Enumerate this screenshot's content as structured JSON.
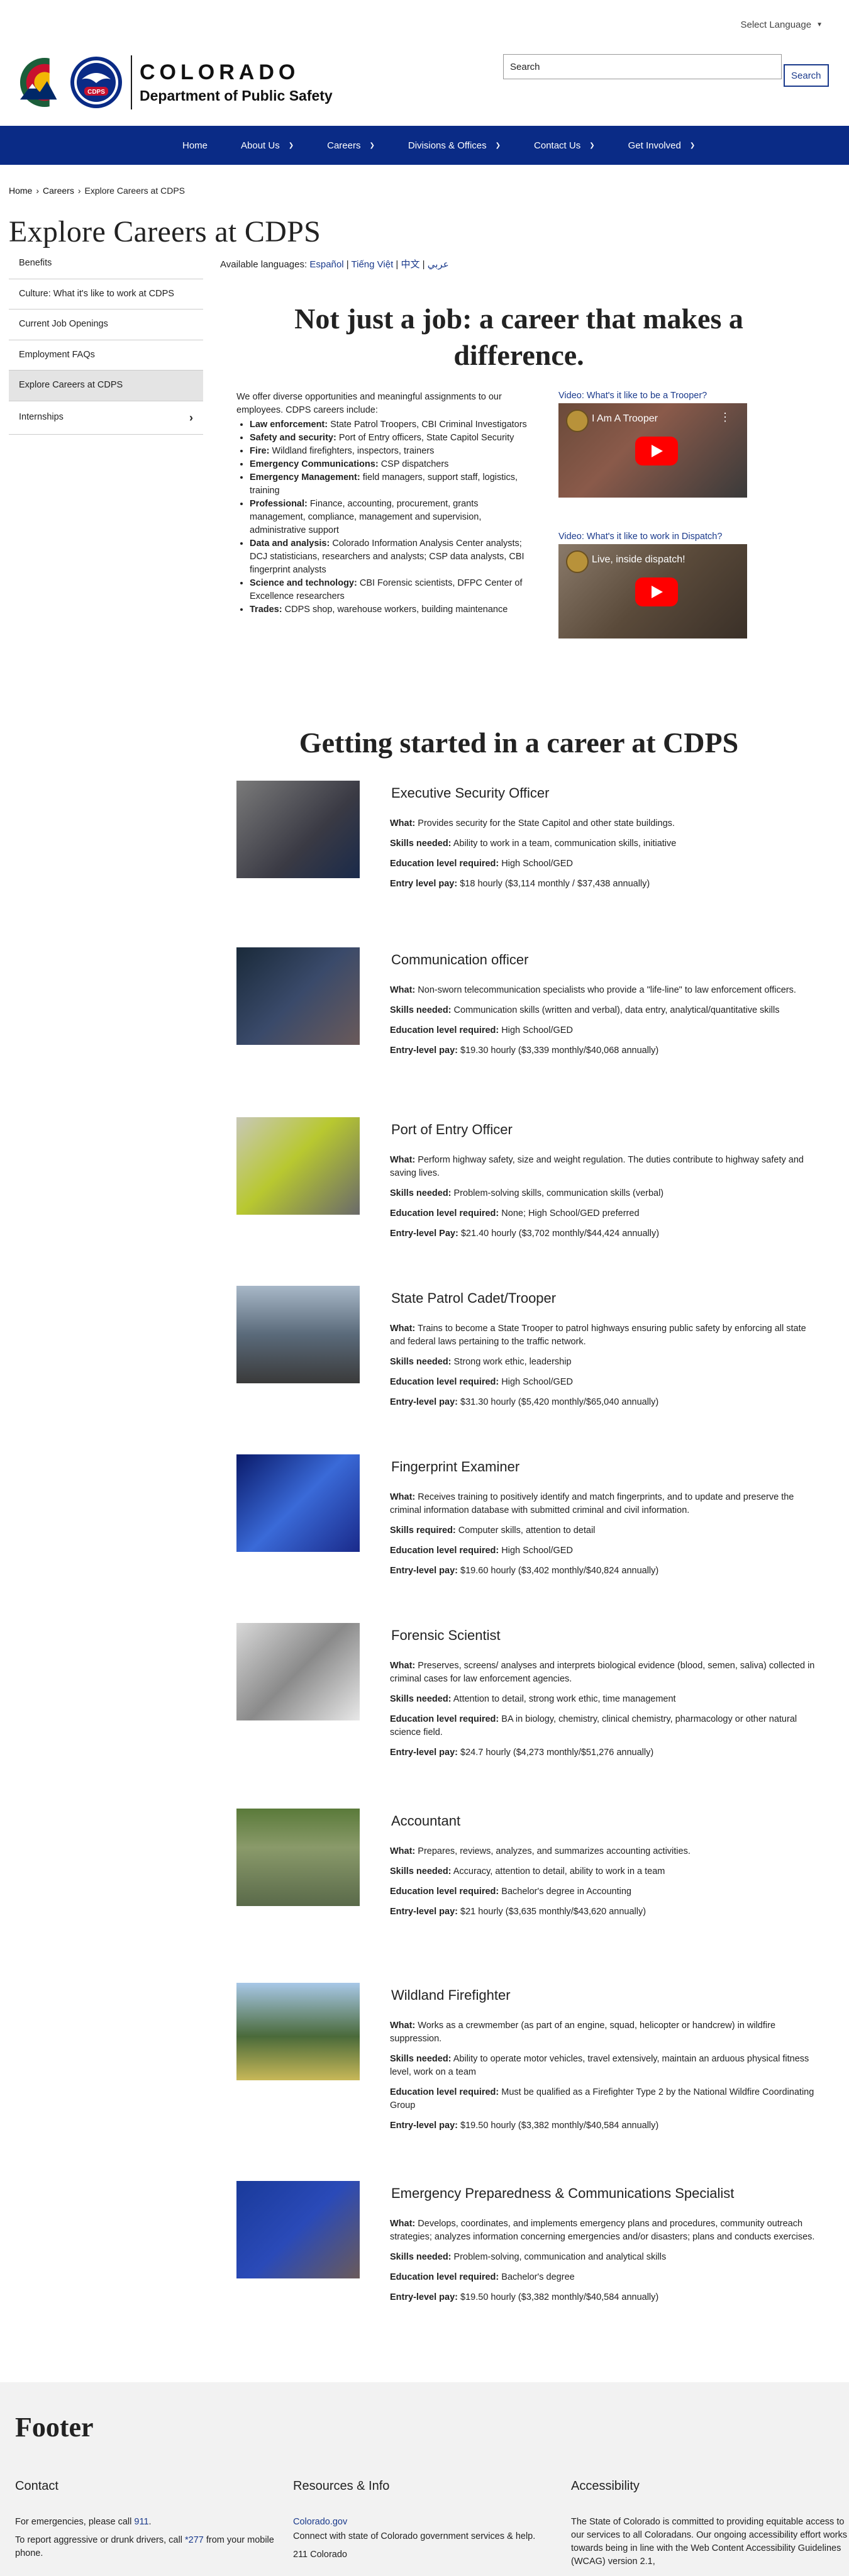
{
  "topbar": {
    "language_label": "Select Language"
  },
  "header": {
    "org_line1": "COLORADO",
    "org_line2": "Department of Public Safety",
    "badge_text": "CDPS",
    "search_placeholder": "Search",
    "search_button": "Search"
  },
  "nav": {
    "items": [
      {
        "label": "Home",
        "has_sub": false
      },
      {
        "label": "About Us",
        "has_sub": true
      },
      {
        "label": "Careers",
        "has_sub": true
      },
      {
        "label": "Divisions & Offices",
        "has_sub": true
      },
      {
        "label": "Contact Us",
        "has_sub": true
      },
      {
        "label": "Get Involved",
        "has_sub": true
      }
    ]
  },
  "breadcrumb": {
    "home": "Home",
    "careers": "Careers",
    "current": "Explore Careers at CDPS",
    "sep": "›"
  },
  "page": {
    "title": "Explore Careers at CDPS"
  },
  "sidebar": {
    "items": [
      {
        "label": "Benefits",
        "active": false
      },
      {
        "label": "Culture: What it's like to work at CDPS",
        "active": false
      },
      {
        "label": "Current Job Openings",
        "active": false
      },
      {
        "label": "Employment FAQs",
        "active": false
      },
      {
        "label": "Explore Careers at CDPS",
        "active": true
      },
      {
        "label": "Internships",
        "active": false,
        "has_sub": true
      }
    ]
  },
  "languages": {
    "label": "Available languages:",
    "items": [
      "Español",
      "Tiếng Việt",
      "中文",
      "عربي"
    ]
  },
  "hero": {
    "title": "Not just a job: a career that makes a difference."
  },
  "intro": {
    "text": "We offer diverse opportunities and meaningful assignments to our employees. CDPS careers include:",
    "bullets": [
      {
        "term": "Law enforcement:",
        "desc": "State Patrol Troopers, CBI Criminal Investigators"
      },
      {
        "term": "Safety and security:",
        "desc": "Port of Entry officers, State Capitol Security"
      },
      {
        "term": "Fire:",
        "desc": "Wildland firefighters, inspectors, trainers"
      },
      {
        "term": "Emergency Communications:",
        "desc": "CSP dispatchers"
      },
      {
        "term": "Emergency Management:",
        "desc": "field managers, support staff, logistics, training"
      },
      {
        "term": "Professional:",
        "desc": "Finance, accounting, procurement, grants management, compliance, management and supervision, administrative support"
      },
      {
        "term": "Data and analysis:",
        "desc": "Colorado Information Analysis Center analysts; DCJ statisticians, researchers and analysts; CSP data analysts, CBI fingerprint analysts"
      },
      {
        "term": "Science and technology:",
        "desc": "CBI Forensic scientists, DFPC Center of Excellence researchers"
      },
      {
        "term": "Trades:",
        "desc": "CDPS shop, warehouse workers, building maintenance"
      }
    ]
  },
  "videos": [
    {
      "link": "Video: What's it like to be a Trooper?",
      "title": "I Am A Trooper"
    },
    {
      "link": "Video: What's it like to work in Dispatch?",
      "title": "Live, inside dispatch!"
    }
  ],
  "section": {
    "title": "Getting started in a career at CDPS"
  },
  "jobs": [
    {
      "title": "Executive Security Officer",
      "rows": [
        {
          "label": "What:",
          "text": "Provides security for the State Capitol and other state buildings."
        },
        {
          "label": "Skills needed:",
          "text": "Ability to work in a team, communication skills, initiative"
        },
        {
          "label": "Education level required:",
          "text": "High School/GED"
        },
        {
          "label": "Entry level pay:",
          "text": "$18 hourly ($3,114 monthly / $37,438 annually)"
        }
      ]
    },
    {
      "title": "Communication officer",
      "rows": [
        {
          "label": "What:",
          "text": "Non-sworn telecommunication specialists who provide a \"life-line\" to law enforcement officers."
        },
        {
          "label": "Skills needed:",
          "text": "Communication skills (written and verbal), data entry, analytical/quantitative skills"
        },
        {
          "label": "Education level required:",
          "text": "High School/GED"
        },
        {
          "label": "Entry-level pay:",
          "text": "$19.30 hourly ($3,339 monthly/$40,068 annually)"
        }
      ]
    },
    {
      "title": "Port of Entry Officer",
      "rows": [
        {
          "label": "What:",
          "text": "Perform highway safety, size and weight regulation. The duties contribute to highway safety and saving lives."
        },
        {
          "label": "Skills needed:",
          "text": "Problem-solving skills, communication skills (verbal)"
        },
        {
          "label": "Education level required:",
          "text": "None; High School/GED preferred"
        },
        {
          "label": "Entry-level Pay:",
          "text": "$21.40 hourly ($3,702 monthly/$44,424 annually)"
        }
      ]
    },
    {
      "title": "State Patrol Cadet/Trooper",
      "rows": [
        {
          "label": "What:",
          "text": "Trains to become a State Trooper to patrol highways ensuring public safety by enforcing all state and federal laws pertaining to the traffic network."
        },
        {
          "label": "Skills needed:",
          "text": "Strong work ethic, leadership"
        },
        {
          "label": "Education level required:",
          "text": "High School/GED"
        },
        {
          "label": "Entry-level pay:",
          "text": "$31.30 hourly ($5,420 monthly/$65,040 annually)"
        }
      ]
    },
    {
      "title": "Fingerprint Examiner",
      "rows": [
        {
          "label": "What:",
          "text": "Receives training to positively identify and match fingerprints, and to update and preserve the criminal information database with submitted criminal and civil information."
        },
        {
          "label": "Skills required:",
          "text": "Computer skills, attention to detail"
        },
        {
          "label": "Education level required:",
          "text": "High School/GED"
        },
        {
          "label": "Entry-level pay:",
          "text": "$19.60 hourly  ($3,402 monthly/$40,824 annually)"
        }
      ]
    },
    {
      "title": "Forensic Scientist",
      "rows": [
        {
          "label": "What:",
          "text": "Preserves, screens/ analyses and interprets biological evidence (blood, semen, saliva) collected in criminal cases for law enforcement agencies."
        },
        {
          "label": "Skills needed:",
          "text": "Attention to detail, strong work ethic, time management"
        },
        {
          "label": "Education level required:",
          "text": "BA in biology, chemistry, clinical chemistry, pharmacology or other natural science field."
        },
        {
          "label": "Entry-level pay:",
          "text": "$24.7 hourly ($4,273 monthly/$51,276 annually)"
        }
      ]
    },
    {
      "title": "Accountant",
      "rows": [
        {
          "label": "What:",
          "text": "Prepares, reviews, analyzes, and summarizes accounting activities."
        },
        {
          "label": "Skills needed:",
          "text": "Accuracy, attention to detail, ability to work in a team"
        },
        {
          "label": "Education level required:",
          "text": "Bachelor's degree in Accounting"
        },
        {
          "label": "Entry-level pay:",
          "text": "$21 hourly ($3,635 monthly/$43,620 annually)"
        }
      ]
    },
    {
      "title": "Wildland Firefighter",
      "rows": [
        {
          "label": "What:",
          "text": "Works as a crewmember (as part of an engine, squad, helicopter or handcrew) in wildfire suppression."
        },
        {
          "label": "Skills needed:",
          "text": "Ability to operate motor vehicles, travel extensively, maintain an arduous physical fitness level, work on a team"
        },
        {
          "label": "Education level required:",
          "text": "Must be qualified as a Firefighter Type 2 by the National Wildfire Coordinating Group"
        },
        {
          "label": "Entry-level pay:",
          "text": "$19.50 hourly ($3,382 monthly/$40,584 annually)"
        }
      ]
    },
    {
      "title": "Emergency Preparedness & Communications Specialist",
      "rows": [
        {
          "label": "What:",
          "text": "Develops, coordinates, and implements emergency plans and procedures, community outreach strategies; analyzes information concerning emergencies and/or disasters; plans and conducts exercises."
        },
        {
          "label": "Skills needed:",
          "text": "Problem-solving, communication and analytical skills"
        },
        {
          "label": "Education level required:",
          "text": "Bachelor's degree"
        },
        {
          "label": "Entry-level pay:",
          "text": "$19.50 hourly ($3,382 monthly/$40,584 annually)"
        }
      ]
    }
  ],
  "footer": {
    "title": "Footer",
    "contact": {
      "heading": "Contact",
      "emergency_pre": "For emergencies, please call ",
      "emergency_num": "911",
      "emergency_post": ".",
      "report_pre": "To report aggressive or drunk drivers, call ",
      "report_num": "*277",
      "report_post": " from your mobile phone."
    },
    "resources": {
      "heading": "Resources & Info",
      "link": "Colorado.gov",
      "desc": "Connect with state of Colorado government services & help.",
      "more": "211 Colorado"
    },
    "accessibility": {
      "heading": "Accessibility",
      "text": "The State of Colorado is committed to providing equitable access to our services to all Coloradans. Our ongoing accessibility effort works towards being in line with the Web Content Accessibility Guidelines (WCAG) version 2.1,"
    }
  }
}
